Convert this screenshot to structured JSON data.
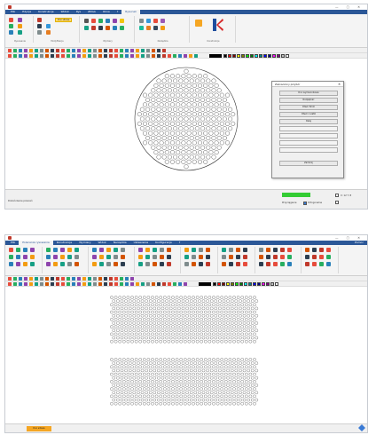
{
  "colors": {
    "tab_bar": "#2b5797",
    "ribbon_bg": "#f4f4f4",
    "highlight": "#ffd966",
    "status_green": "#33cc33",
    "orange_tag": "#f5a623",
    "logo_red": "#d62728",
    "logo_blue": "#1f4e9e"
  },
  "palette": [
    "#000000",
    "#ff0000",
    "#800000",
    "#ffff00",
    "#808000",
    "#00ff00",
    "#008000",
    "#00ffff",
    "#008080",
    "#0000ff",
    "#000080",
    "#ff00ff",
    "#800080",
    "#c0c0c0",
    "#ffffff"
  ],
  "shot1": {
    "window": {
      "controls": "—  ▢  ✕"
    },
    "tabs": [
      "Plik",
      "Edycja",
      "Konstrukcje",
      "Widok",
      "Rys",
      "ZDGA",
      "Okna",
      "?",
      "Rysunek"
    ],
    "ribbon": {
      "highlight_button": "Dno sitowe",
      "group_labels": [
        "Rysowanie",
        "Modyfikacja",
        "Wymiary",
        "Narzędzia",
        "Konstrukcje"
      ]
    },
    "dialog": {
      "title": "Zaznaczony przybór",
      "close": "✕",
      "buttons": [
        "Dno wymiennikowe",
        "Rozpiętość",
        "Otwór 8mm",
        "Otwór z siatki",
        "Dalej",
        "",
        "",
        "",
        ""
      ],
      "ok": "Zamknij"
    },
    "status": {
      "left_text": "Dokończenie poleceń",
      "label_a": "Przyciąganie",
      "label_b": "Ortogonalne",
      "label_c": "X: 12  Y: 8"
    }
  },
  "shot2": {
    "tabs": [
      "Plik",
      "Polecenia rysowania",
      "Konstrukcje",
      "Wymiary",
      "Widok",
      "Narzędzia",
      "Ustawienia",
      "Konfiguracja",
      "?"
    ],
    "right_tab": "Pomoc",
    "status": {
      "tag": "Dno sitowe"
    }
  }
}
